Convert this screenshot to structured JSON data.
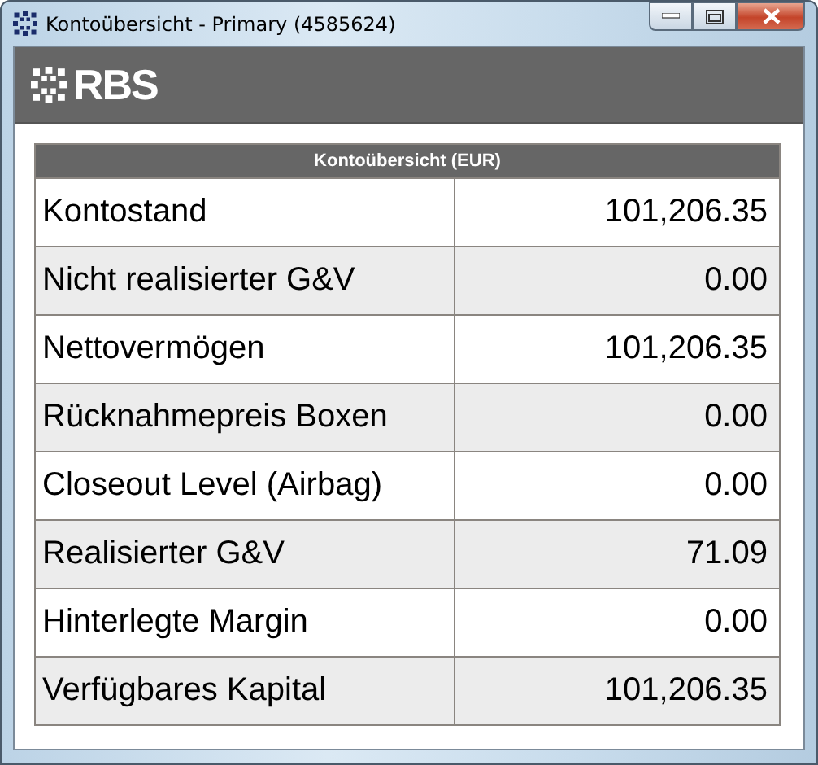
{
  "window": {
    "title": "Kontoübersicht - Primary (4585624)"
  },
  "header": {
    "logo_text": "RBS"
  },
  "table": {
    "title": "Kontoübersicht (EUR)",
    "rows": [
      {
        "label": "Kontostand",
        "value": "101,206.35"
      },
      {
        "label": "Nicht realisierter G&V",
        "value": "0.00"
      },
      {
        "label": "Nettovermögen",
        "value": "101,206.35"
      },
      {
        "label": "Rücknahmepreis Boxen",
        "value": "0.00"
      },
      {
        "label": "Closeout Level (Airbag)",
        "value": "0.00"
      },
      {
        "label": "Realisierter G&V",
        "value": "71.09"
      },
      {
        "label": "Hinterlegte Margin",
        "value": "0.00"
      },
      {
        "label": "Verfügbares Kapital",
        "value": "101,206.35"
      }
    ]
  }
}
